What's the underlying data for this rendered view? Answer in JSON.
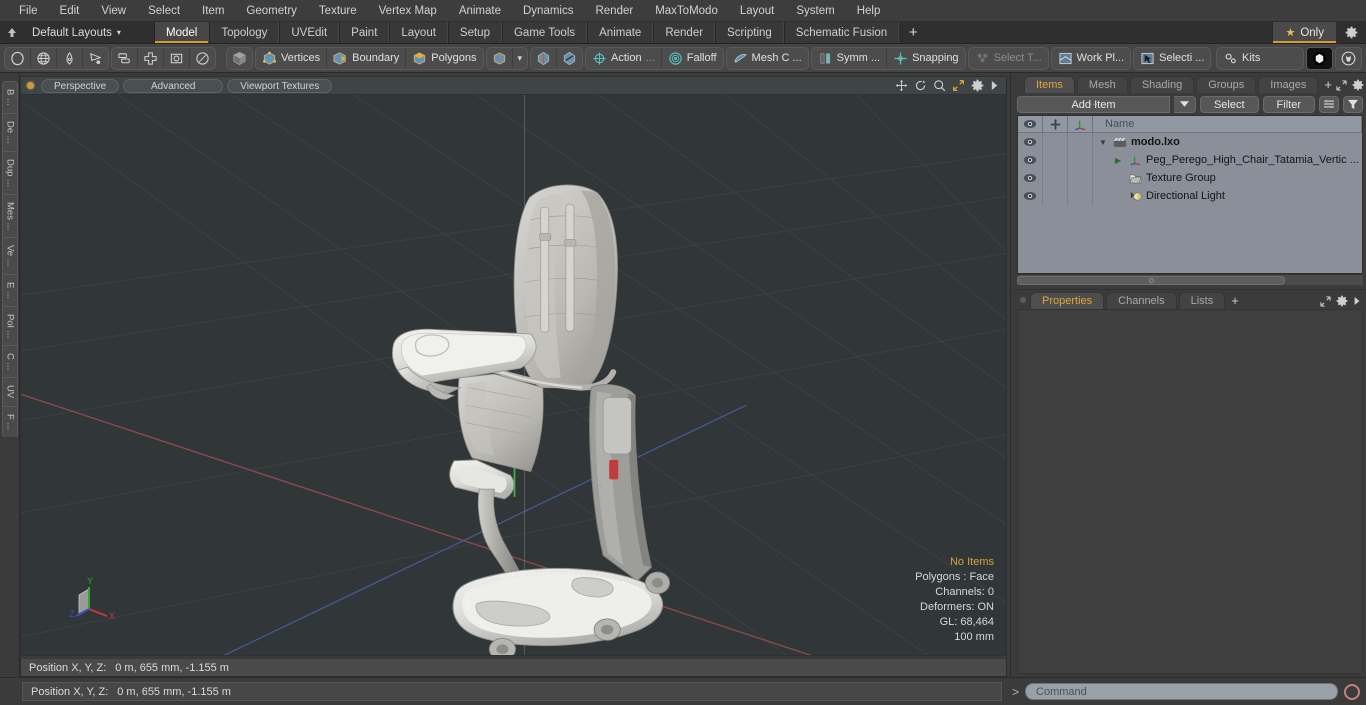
{
  "menu": {
    "items": [
      "File",
      "Edit",
      "View",
      "Select",
      "Item",
      "Geometry",
      "Texture",
      "Vertex Map",
      "Animate",
      "Dynamics",
      "Render",
      "MaxToModo",
      "Layout",
      "System",
      "Help"
    ]
  },
  "layoutbar": {
    "layouts_label": "Default Layouts",
    "caret": "▾",
    "tabs": [
      {
        "label": "Model",
        "active": true
      },
      {
        "label": "Topology",
        "active": false
      },
      {
        "label": "UVEdit",
        "active": false
      },
      {
        "label": "Paint",
        "active": false
      },
      {
        "label": "Layout",
        "active": false
      },
      {
        "label": "Setup",
        "active": false
      },
      {
        "label": "Game Tools",
        "active": false
      },
      {
        "label": "Animate",
        "active": false
      },
      {
        "label": "Render",
        "active": false
      },
      {
        "label": "Scripting",
        "active": false
      },
      {
        "label": "Schematic Fusion",
        "active": false
      }
    ],
    "add_tab_label": "+",
    "only_label": "Only",
    "only_star": "★"
  },
  "toolbar": {
    "shape_tools": [
      "ellipse-icon",
      "globe-icon",
      "pen-icon",
      "curve-icon"
    ],
    "prim_tools": [
      "cube-prim-icon",
      "cross-prim-icon",
      "square-prim-icon",
      "circle-prim-icon"
    ],
    "selection_mode_icon": "cube-shaded-icon",
    "modes": [
      {
        "label": "Vertices",
        "icon": "vertices-icon"
      },
      {
        "label": "Boundary",
        "icon": "boundary-icon"
      },
      {
        "label": "Polygons",
        "icon": "polygons-icon"
      }
    ],
    "mode_extra_icon": "cube-outline-icon",
    "mode_caret": "▾",
    "symmetry_icons": [
      "mirror-a-icon",
      "mirror-b-icon"
    ],
    "action": {
      "label": "Action",
      "ellipsis": "...",
      "icon": "action-center-icon"
    },
    "falloff": {
      "label": "Falloff",
      "icon": "falloff-icon"
    },
    "mesh_constraint": {
      "label": "Mesh C ...",
      "icon": "mesh-constraint-icon"
    },
    "symm": {
      "label": "Symm ...",
      "icon": "symmetry-icon"
    },
    "snapping": {
      "label": "Snapping",
      "icon": "snapping-icon"
    },
    "select_through": {
      "label": "Select T...",
      "icon": "select-through-icon",
      "disabled": true
    },
    "work_plane": {
      "label": "Work Pl...",
      "icon": "work-plane-icon"
    },
    "selection_set": {
      "label": "Selecti ...",
      "icon": "selection-icon"
    },
    "kits": {
      "label": "Kits",
      "icon": "kits-gear-icon"
    },
    "app_icons": [
      "modo-ball-icon",
      "unreal-engine-icon"
    ]
  },
  "vertical_tabs": [
    "B ...",
    "De ...",
    "Dup ...",
    "Mes ...",
    "Ve ...",
    "E ...",
    "Pol ...",
    "C ...",
    "UV",
    "F ..."
  ],
  "viewport": {
    "header": {
      "pills": [
        "Perspective",
        "Advanced",
        "Viewport Textures"
      ],
      "icons": [
        "move-view-icon",
        "rotate-view-icon",
        "zoom-view-icon",
        "fit-view-icon",
        "viewport-gear-icon",
        "viewport-more-icon"
      ]
    },
    "hud": {
      "no_items": "No Items",
      "polygons": "Polygons : Face",
      "channels": "Channels: 0",
      "deformers": "Deformers: ON",
      "gl": "GL: 68,464",
      "scale": "100 mm"
    },
    "axis": {
      "x": "X",
      "y": "Y",
      "z": "Z"
    },
    "colors": {
      "background": "#313638",
      "grid": "#3d4345",
      "x_axis": "#8a4b4b",
      "y_axis": "#4e8a4e",
      "z_axis": "#4b5c8a",
      "model": "#d8d8d4"
    },
    "footer": {
      "position_label": "Position X, Y, Z:",
      "position_value": "0 m, 655 mm, -1.155 m"
    }
  },
  "right_panel": {
    "tabs": [
      {
        "label": "Items",
        "active": true
      },
      {
        "label": "Mesh ...",
        "active": false
      },
      {
        "label": "Shading",
        "active": false
      },
      {
        "label": "Groups",
        "active": false
      },
      {
        "label": "Images",
        "active": false
      }
    ],
    "tab_plus": "+",
    "tab_icons": [
      "expand-arrows-icon",
      "panel-gear-icon",
      "panel-more-icon"
    ],
    "tools": {
      "add_item_label": "Add Item",
      "add_item_caret": "▾",
      "select_label": "Select",
      "filter_label": "Filter",
      "sort_icon": "sort-icon",
      "filter_icon": "funnel-icon"
    },
    "list": {
      "columns": [
        "eye-icon",
        "lock-icon",
        "transform-icon",
        "Name"
      ],
      "rows": [
        {
          "name": "modo.lxo",
          "icon": "scene-clapper-icon",
          "bold": true,
          "indent": 0,
          "expander": "▼"
        },
        {
          "name": "Peg_Perego_High_Chair_Tatamia_Vertic ...",
          "icon": "mesh-axis-icon",
          "bold": false,
          "indent": 1,
          "expander": "▶"
        },
        {
          "name": "Texture Group",
          "icon": "texture-group-icon",
          "bold": false,
          "indent": 1,
          "expander": ""
        },
        {
          "name": "Directional Light",
          "icon": "directional-light-icon",
          "bold": false,
          "indent": 1,
          "expander": ""
        }
      ]
    },
    "property_tabs": [
      {
        "label": "Properties",
        "active": true
      },
      {
        "label": "Channels",
        "active": false
      },
      {
        "label": "Lists",
        "active": false
      }
    ],
    "property_tab_plus": "+",
    "property_tab_icons": [
      "expand-arrows-icon",
      "properties-gear-icon",
      "properties-more-icon"
    ]
  },
  "bottom": {
    "command_prompt": ">",
    "command_placeholder": "Command",
    "record_icon": "record-icon"
  }
}
